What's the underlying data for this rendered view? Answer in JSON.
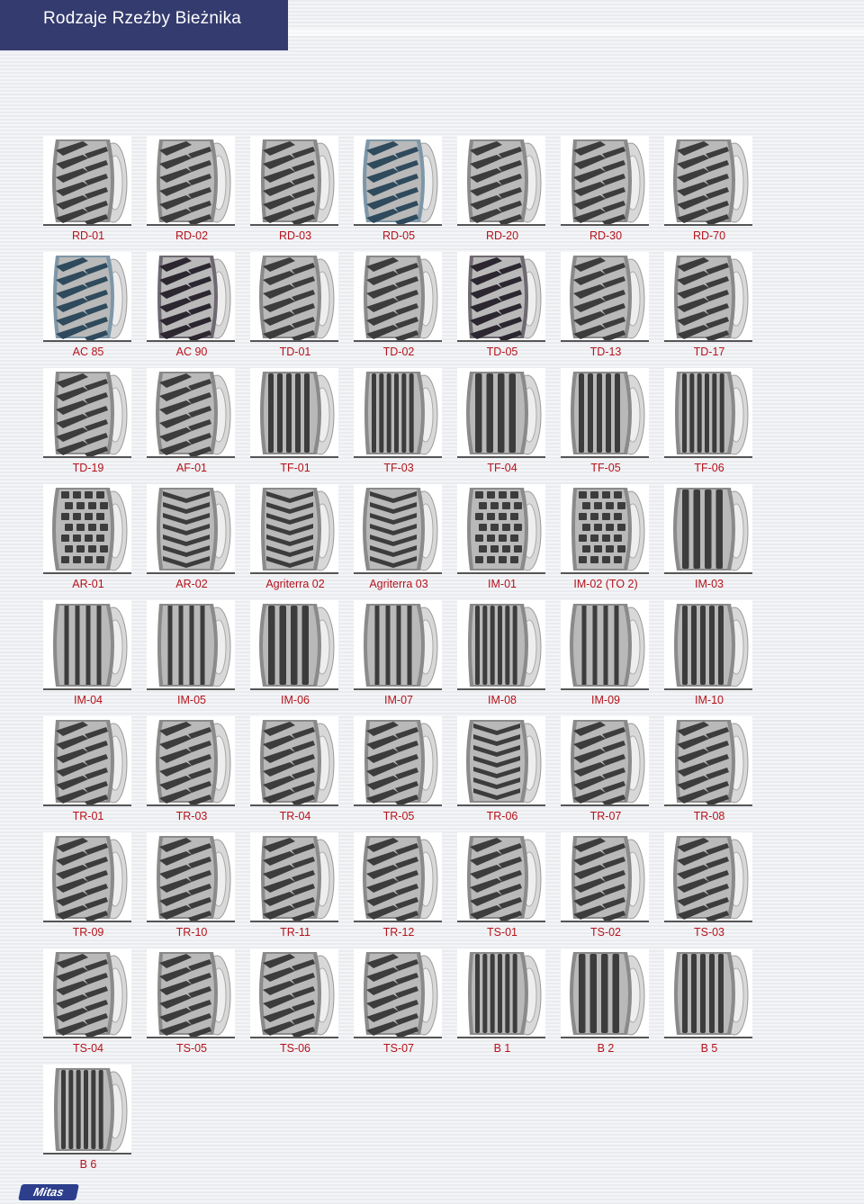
{
  "header": {
    "title": "Rodzaje Rzeźby Bieżnika"
  },
  "brand": {
    "logo_text": "Mitas",
    "color": "#2c3e8c"
  },
  "colors": {
    "header_bg": "#343b6e",
    "label": "#b5121b"
  },
  "tread_patterns": [
    {
      "label": "RD-01",
      "kind": "lug"
    },
    {
      "label": "RD-02",
      "kind": "lug"
    },
    {
      "label": "RD-03",
      "kind": "lug"
    },
    {
      "label": "RD-05",
      "kind": "lug-blue"
    },
    {
      "label": "RD-20",
      "kind": "lug"
    },
    {
      "label": "RD-30",
      "kind": "lug"
    },
    {
      "label": "RD-70",
      "kind": "lug"
    },
    {
      "label": "AC 85",
      "kind": "lug-blue"
    },
    {
      "label": "AC 90",
      "kind": "lug-dark"
    },
    {
      "label": "TD-01",
      "kind": "lug"
    },
    {
      "label": "TD-02",
      "kind": "lug"
    },
    {
      "label": "TD-05",
      "kind": "lug-dark"
    },
    {
      "label": "TD-13",
      "kind": "lug"
    },
    {
      "label": "TD-17",
      "kind": "lug"
    },
    {
      "label": "TD-19",
      "kind": "lug"
    },
    {
      "label": "AF-01",
      "kind": "lug"
    },
    {
      "label": "TF-01",
      "kind": "rib"
    },
    {
      "label": "TF-03",
      "kind": "rib"
    },
    {
      "label": "TF-04",
      "kind": "rib"
    },
    {
      "label": "TF-05",
      "kind": "rib"
    },
    {
      "label": "TF-06",
      "kind": "rib"
    },
    {
      "label": "AR-01",
      "kind": "block"
    },
    {
      "label": "AR-02",
      "kind": "chevron"
    },
    {
      "label": "Agriterra 02",
      "kind": "chevron"
    },
    {
      "label": "Agriterra 03",
      "kind": "chevron"
    },
    {
      "label": "IM-01",
      "kind": "block"
    },
    {
      "label": "IM-02 (TO 2)",
      "kind": "block"
    },
    {
      "label": "IM-03",
      "kind": "rib"
    },
    {
      "label": "IM-04",
      "kind": "wave"
    },
    {
      "label": "IM-05",
      "kind": "wave"
    },
    {
      "label": "IM-06",
      "kind": "rib"
    },
    {
      "label": "IM-07",
      "kind": "wave"
    },
    {
      "label": "IM-08",
      "kind": "rib"
    },
    {
      "label": "IM-09",
      "kind": "wave"
    },
    {
      "label": "IM-10",
      "kind": "rib"
    },
    {
      "label": "TR-01",
      "kind": "lug"
    },
    {
      "label": "TR-03",
      "kind": "lug"
    },
    {
      "label": "TR-04",
      "kind": "lug"
    },
    {
      "label": "TR-05",
      "kind": "lug"
    },
    {
      "label": "TR-06",
      "kind": "chevron"
    },
    {
      "label": "TR-07",
      "kind": "lug"
    },
    {
      "label": "TR-08",
      "kind": "lug"
    },
    {
      "label": "TR-09",
      "kind": "lug"
    },
    {
      "label": "TR-10",
      "kind": "lug"
    },
    {
      "label": "TR-11",
      "kind": "lug"
    },
    {
      "label": "TR-12",
      "kind": "lug"
    },
    {
      "label": "TS-01",
      "kind": "lug"
    },
    {
      "label": "TS-02",
      "kind": "lug"
    },
    {
      "label": "TS-03",
      "kind": "lug"
    },
    {
      "label": "TS-04",
      "kind": "lug"
    },
    {
      "label": "TS-05",
      "kind": "lug"
    },
    {
      "label": "TS-06",
      "kind": "lug"
    },
    {
      "label": "TS-07",
      "kind": "lug"
    },
    {
      "label": "B 1",
      "kind": "rib"
    },
    {
      "label": "B 2",
      "kind": "rib"
    },
    {
      "label": "B 5",
      "kind": "rib"
    },
    {
      "label": "B 6",
      "kind": "rib"
    }
  ]
}
